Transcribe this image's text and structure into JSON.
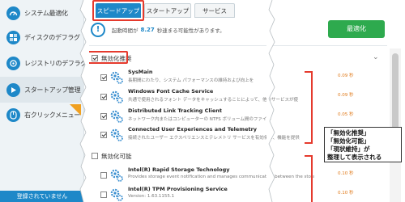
{
  "sidebar": {
    "items": [
      {
        "label": "システム最適化",
        "icon": "gauge-icon"
      },
      {
        "label": "ディスクのデフラグ",
        "icon": "disk-defrag-icon"
      },
      {
        "label": "レジストリのデフラグ",
        "icon": "registry-defrag-icon"
      },
      {
        "label": "スタートアップ管理",
        "icon": "startup-icon"
      },
      {
        "label": "右クリックメニュー",
        "icon": "right-click-menu-icon"
      }
    ],
    "footer": "登録されていません"
  },
  "tabs": [
    "スピードアップ",
    "スタートアップ",
    "サービス"
  ],
  "startup_info": {
    "prefix": "起動時間が",
    "value": "8.27",
    "suffix": "秒速まる可能性があります。"
  },
  "optimize_button": "最適化",
  "sections": [
    {
      "title": "無効化推奨",
      "checked": true
    },
    {
      "title": "無効化可能",
      "checked": false
    }
  ],
  "services": [
    {
      "name": "SysMain",
      "desc": "長期間にわたり、システム パフォーマンスの維持および向上を",
      "time": "0.09 秒",
      "checked": true
    },
    {
      "name": "Windows Font Cache Service",
      "desc": "共通で使用されるフォント データをキャッシュすることによって、他のサービスが使",
      "time": "0.09 秒",
      "checked": true
    },
    {
      "name": "Distributed Link Tracking Client",
      "desc": "ネットワーク内またはコンピューターの NTFS ボリューム間のファイル",
      "time": "0.05 秒",
      "checked": true
    },
    {
      "name": "Connected User Experiences and Telemetry",
      "desc": "接続されたユーザー エクスペリエンスとテレメトリ サービスを有効化し、機能を提供",
      "time": "",
      "checked": true
    },
    {
      "name": "Intel(R) Rapid Storage Technology",
      "desc": "Provides storage event notification and manages communication between the storage applica...",
      "time": "0.10 秒",
      "checked": false
    },
    {
      "name": "Intel(R) TPM Provisioning Service",
      "desc": "Version: 1.63.1155.1",
      "time": "0.10 秒",
      "checked": false
    }
  ],
  "callout": [
    "「無効化推奨」",
    "「無効化可能」",
    "「現状維持」が",
    "整理して表示される"
  ],
  "colors": {
    "accent": "#1e88c8",
    "highlight": "#e53a2d",
    "optimize": "#2eaa4e",
    "time": "#e07a1a"
  }
}
